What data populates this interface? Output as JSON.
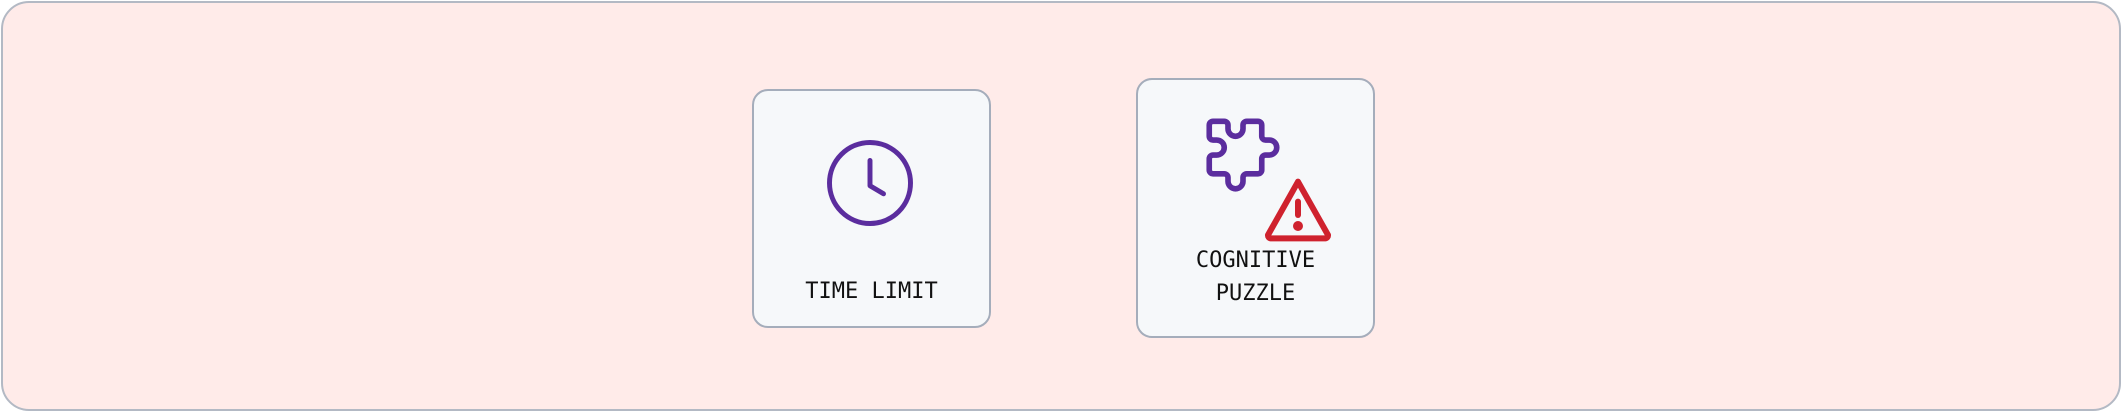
{
  "colors": {
    "background_panel": "#ffebe9",
    "card_background": "#f6f8fa",
    "card_border": "#a5adbb",
    "icon_purple": "#5b2d9e",
    "icon_red": "#cf222e"
  },
  "cards": [
    {
      "icon": "clock-icon",
      "label": "TIME LIMIT"
    },
    {
      "icons": [
        "puzzle-icon",
        "alert-triangle-icon"
      ],
      "label_line1": "COGNITIVE",
      "label_line2": "PUZZLE"
    }
  ]
}
